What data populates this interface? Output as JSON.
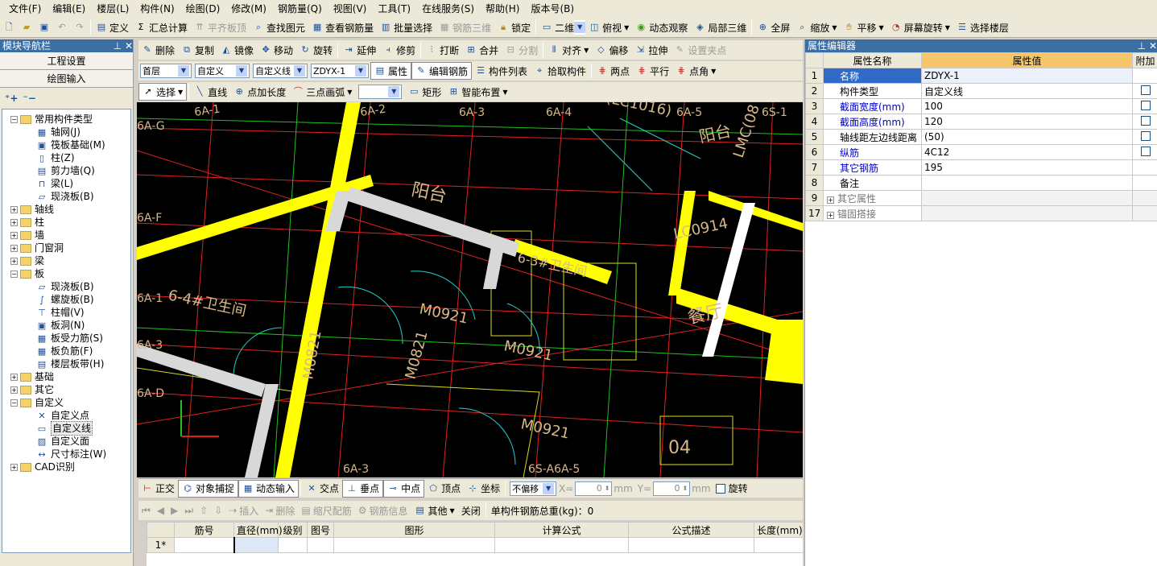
{
  "menu": [
    "文件(F)",
    "编辑(E)",
    "楼层(L)",
    "构件(N)",
    "绘图(D)",
    "修改(M)",
    "钢筋量(Q)",
    "视图(V)",
    "工具(T)",
    "在线服务(S)",
    "帮助(H)",
    "版本号(B)"
  ],
  "toolbar1": {
    "define": "定义",
    "sum": "汇总计算",
    "flush": "平齐板顶",
    "find": "查找图元",
    "view_rebar": "查看钢筋量",
    "batch": "批量选择",
    "rebar3d": "钢筋三维",
    "lock": "锁定",
    "view2d": "二维",
    "top": "俯视",
    "dyn": "动态观察",
    "local3d": "局部三维",
    "full": "全屏",
    "zoom": "缩放",
    "pan": "平移",
    "rotate": "屏幕旋转",
    "select_floor": "选择楼层"
  },
  "toolbar2": {
    "delete": "删除",
    "copy": "复制",
    "mirror": "镜像",
    "move": "移动",
    "rotate": "旋转",
    "extend": "延伸",
    "trim": "修剪",
    "break": "打断",
    "merge": "合并",
    "split": "分割",
    "align": "对齐",
    "offset": "偏移",
    "stretch": "拉伸",
    "grip": "设置夹点"
  },
  "toolbar3": {
    "floor": "首层",
    "cat1": "自定义",
    "cat2": "自定义线",
    "comp": "ZDYX-1",
    "props": "属性",
    "edit_rebar": "编辑钢筋",
    "comp_list": "构件列表",
    "pick": "拾取构件",
    "two_pts": "两点",
    "parallel": "平行",
    "pt_angle": "点角"
  },
  "toolbar4": {
    "select": "选择",
    "line": "直线",
    "pt_len": "点加长度",
    "arc3": "三点画弧",
    "rect": "矩形",
    "smart": "智能布置"
  },
  "nav": {
    "title": "模块导航栏",
    "btn1": "工程设置",
    "btn2": "绘图输入"
  },
  "tree": [
    {
      "lvl": 0,
      "exp": "−",
      "type": "folder",
      "label": "常用构件类型"
    },
    {
      "lvl": 1,
      "icon": "▦",
      "label": "轴网(J)"
    },
    {
      "lvl": 1,
      "icon": "▣",
      "label": "筏板基础(M)"
    },
    {
      "lvl": 1,
      "icon": "▯",
      "label": "柱(Z)"
    },
    {
      "lvl": 1,
      "icon": "▤",
      "label": "剪力墙(Q)"
    },
    {
      "lvl": 1,
      "icon": "⊓",
      "label": "梁(L)"
    },
    {
      "lvl": 1,
      "icon": "▱",
      "label": "现浇板(B)"
    },
    {
      "lvl": 0,
      "exp": "+",
      "type": "folder",
      "label": "轴线"
    },
    {
      "lvl": 0,
      "exp": "+",
      "type": "folder",
      "label": "柱"
    },
    {
      "lvl": 0,
      "exp": "+",
      "type": "folder",
      "label": "墙"
    },
    {
      "lvl": 0,
      "exp": "+",
      "type": "folder",
      "label": "门窗洞"
    },
    {
      "lvl": 0,
      "exp": "+",
      "type": "folder",
      "label": "梁"
    },
    {
      "lvl": 0,
      "exp": "−",
      "type": "folder",
      "label": "板"
    },
    {
      "lvl": 1,
      "icon": "▱",
      "label": "现浇板(B)"
    },
    {
      "lvl": 1,
      "icon": "∫",
      "label": "螺旋板(B)"
    },
    {
      "lvl": 1,
      "icon": "⊤",
      "label": "柱帽(V)"
    },
    {
      "lvl": 1,
      "icon": "▣",
      "label": "板洞(N)"
    },
    {
      "lvl": 1,
      "icon": "▦",
      "label": "板受力筋(S)"
    },
    {
      "lvl": 1,
      "icon": "▦",
      "label": "板负筋(F)"
    },
    {
      "lvl": 1,
      "icon": "▤",
      "label": "楼层板带(H)"
    },
    {
      "lvl": 0,
      "exp": "+",
      "type": "folder",
      "label": "基础"
    },
    {
      "lvl": 0,
      "exp": "+",
      "type": "folder",
      "label": "其它"
    },
    {
      "lvl": 0,
      "exp": "−",
      "type": "folder",
      "label": "自定义"
    },
    {
      "lvl": 1,
      "icon": "✕",
      "label": "自定义点"
    },
    {
      "lvl": 1,
      "icon": "▭",
      "label": "自定义线",
      "selected": true
    },
    {
      "lvl": 1,
      "icon": "▨",
      "label": "自定义面"
    },
    {
      "lvl": 1,
      "icon": "↔",
      "label": "尺寸标注(W)"
    },
    {
      "lvl": 0,
      "exp": "+",
      "type": "folder",
      "label": "CAD识别"
    }
  ],
  "cad_labels": [
    "6A-1",
    "6A-2",
    "6A-3",
    "6A-4",
    "6A-5",
    "6S-1",
    "6A-G",
    "6A-F",
    "6A-1",
    "6A-3",
    "6A-D",
    "6A-3",
    "6S-A6A-5",
    "阳台",
    "阳台",
    "6-4#卫生间",
    "6-3#卫生间",
    "M0921",
    "M0921",
    "M0921",
    "M0821",
    "M0821",
    "LC0914",
    "餐厅",
    "04",
    "(LC1016)",
    "LMC(08"
  ],
  "snapbar": {
    "ortho": "正交",
    "osnap": "对象捕捉",
    "dyn_input": "动态输入",
    "intersect": "交点",
    "perp": "垂点",
    "mid": "中点",
    "vertex": "顶点",
    "coord": "坐标",
    "no_offset": "不偏移",
    "x_label": "X=",
    "x_val": "0",
    "unit": "mm",
    "y_label": "Y=",
    "y_val": "0",
    "rotate": "旋转"
  },
  "rebarbar": {
    "insert": "插入",
    "delete": "删除",
    "scale": "缩尺配筋",
    "info": "钢筋信息",
    "other": "其他",
    "close": "关闭",
    "total": "单构件钢筋总重(kg)：0"
  },
  "rebar_grid": {
    "headers": [
      "筋号",
      "直径(mm)",
      "级别",
      "图号",
      "图形",
      "计算公式",
      "公式描述",
      "长度(mm)"
    ],
    "row1": "1*"
  },
  "props": {
    "title": "属性编辑器",
    "col_name": "属性名称",
    "col_value": "属性值",
    "col_add": "附加",
    "rows": [
      {
        "n": "1",
        "name": "名称",
        "value": "ZDYX-1",
        "blue": true,
        "chk": false,
        "sel": true
      },
      {
        "n": "2",
        "name": "构件类型",
        "value": "自定义线",
        "blue": false,
        "chk": true
      },
      {
        "n": "3",
        "name": "截面宽度(mm)",
        "value": "100",
        "blue": true,
        "chk": true
      },
      {
        "n": "4",
        "name": "截面高度(mm)",
        "value": "120",
        "blue": true,
        "chk": true
      },
      {
        "n": "5",
        "name": "轴线距左边线距离",
        "value": "(50)",
        "blue": false,
        "chk": true
      },
      {
        "n": "6",
        "name": "纵筋",
        "value": "4C12",
        "blue": true,
        "chk": true
      },
      {
        "n": "7",
        "name": "其它钢筋",
        "value": "195",
        "blue": true,
        "chk": false
      },
      {
        "n": "8",
        "name": "备注",
        "value": "",
        "blue": false,
        "chk": false
      },
      {
        "n": "9",
        "name": "其它属性",
        "value": "",
        "blue": false,
        "chk": false,
        "group": true
      },
      {
        "n": "17",
        "name": "锚固搭接",
        "value": "",
        "blue": false,
        "chk": false,
        "group": true
      }
    ]
  }
}
